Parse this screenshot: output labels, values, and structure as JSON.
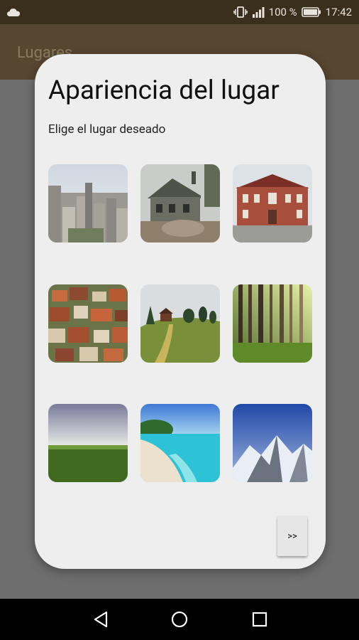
{
  "status_bar": {
    "battery_percent": "100 %",
    "time": "17:42",
    "icons": [
      "cloud-icon",
      "vibrate-icon",
      "signal-icon",
      "battery-icon"
    ]
  },
  "app_bar": {
    "title": "Lugares"
  },
  "dialog": {
    "title": "Apariencia del lugar",
    "subtitle": "Elige el lugar deseado",
    "places": [
      {
        "name": "city-skyline"
      },
      {
        "name": "old-house"
      },
      {
        "name": "brick-mansion"
      },
      {
        "name": "village-rooftops"
      },
      {
        "name": "hill-cabin"
      },
      {
        "name": "sunlit-forest"
      },
      {
        "name": "green-field"
      },
      {
        "name": "tropical-beach"
      },
      {
        "name": "snowy-mountains"
      }
    ],
    "next_label": ">>"
  },
  "nav_bar": {
    "buttons": [
      "back-icon",
      "home-icon",
      "recents-icon"
    ]
  }
}
